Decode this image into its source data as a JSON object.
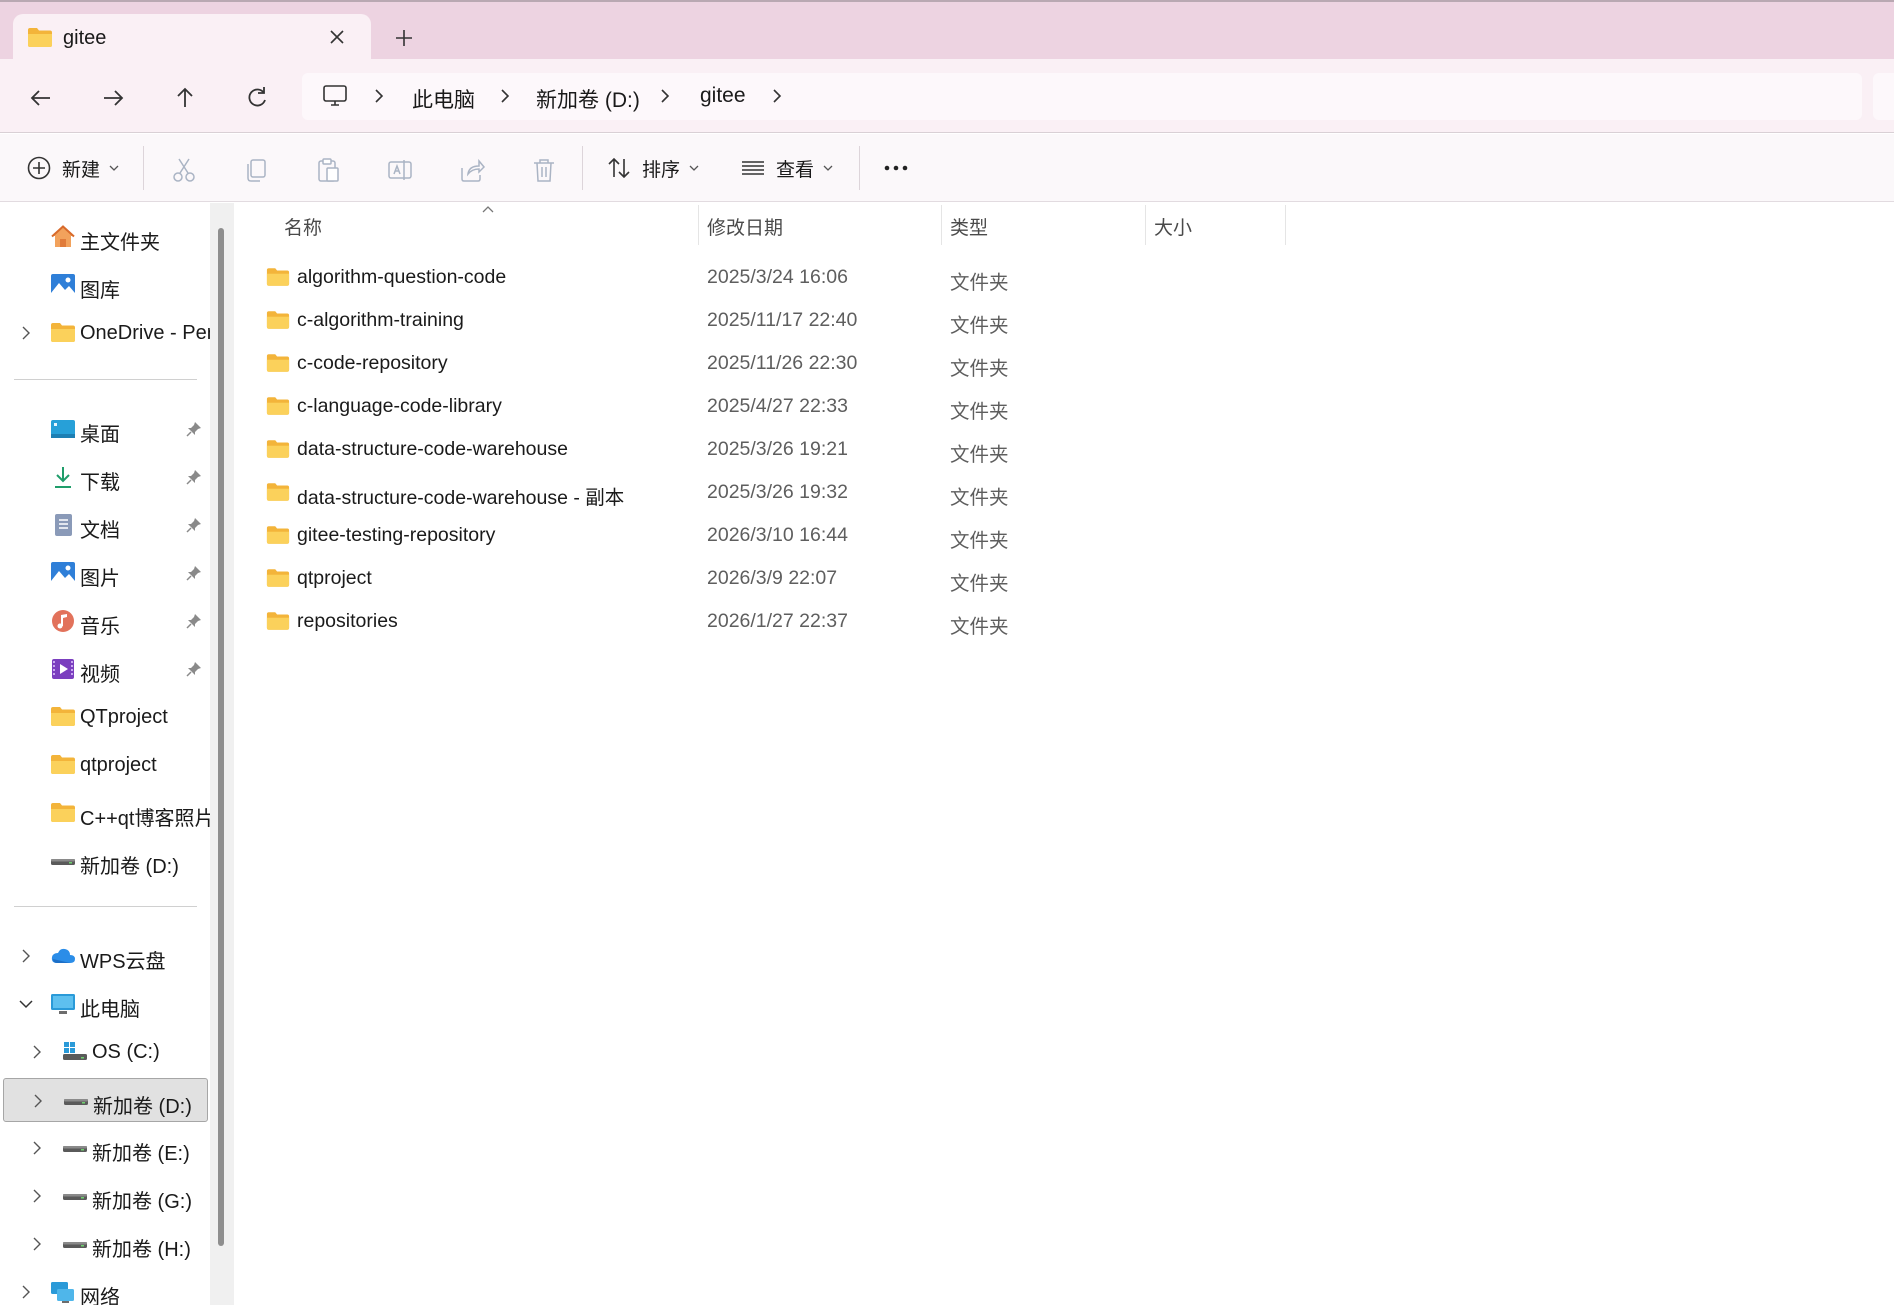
{
  "tab": {
    "title": "gitee",
    "folder_icon": "folder-icon",
    "close_icon": "close-icon"
  },
  "new_tab_icon": "plus-icon",
  "nav_buttons": [
    "back-arrow-icon",
    "forward-arrow-icon",
    "up-arrow-icon",
    "refresh-icon"
  ],
  "breadcrumb": [
    {
      "label": "此电脑"
    },
    {
      "label": "新加卷 (D:)"
    },
    {
      "label": "gitee"
    }
  ],
  "toolbar": {
    "new_label": "新建",
    "sort_label": "排序",
    "view_label": "查看",
    "more_label": "···"
  },
  "sidebar": {
    "quick": [
      {
        "label": "主文件夹",
        "icon": "home-icon"
      },
      {
        "label": "图库",
        "icon": "gallery-icon"
      },
      {
        "label": "OneDrive - Per",
        "icon": "folder-icon"
      }
    ],
    "pinned": [
      {
        "label": "桌面",
        "icon": "desktop-icon",
        "pinned": true
      },
      {
        "label": "下载",
        "icon": "download-icon",
        "pinned": true
      },
      {
        "label": "文档",
        "icon": "document-icon",
        "pinned": true
      },
      {
        "label": "图片",
        "icon": "pictures-icon",
        "pinned": true
      },
      {
        "label": "音乐",
        "icon": "music-icon",
        "pinned": true
      },
      {
        "label": "视频",
        "icon": "video-icon",
        "pinned": true
      },
      {
        "label": "QTproject",
        "icon": "folder-icon"
      },
      {
        "label": "qtproject",
        "icon": "folder-icon"
      },
      {
        "label": "C++qt博客照片",
        "icon": "folder-icon"
      },
      {
        "label": "新加卷 (D:)",
        "icon": "drive-icon"
      }
    ],
    "tree": [
      {
        "label": "WPS云盘",
        "icon": "cloud-icon"
      },
      {
        "label": "此电脑",
        "icon": "computer-icon",
        "expanded": true
      },
      {
        "label": "OS (C:)",
        "icon": "windows-drive-icon"
      },
      {
        "label": "新加卷 (D:)",
        "icon": "drive-icon",
        "selected": true
      },
      {
        "label": "新加卷 (E:)",
        "icon": "drive-icon"
      },
      {
        "label": "新加卷 (G:)",
        "icon": "drive-icon"
      },
      {
        "label": "新加卷 (H:)",
        "icon": "drive-icon"
      },
      {
        "label": "网络",
        "icon": "network-icon"
      }
    ]
  },
  "columns": {
    "name": "名称",
    "date": "修改日期",
    "type": "类型",
    "size": "大小"
  },
  "files": [
    {
      "name": "algorithm-question-code",
      "date": "2025/3/24 16:06",
      "type": "文件夹"
    },
    {
      "name": "c-algorithm-training",
      "date": "2025/11/17 22:40",
      "type": "文件夹"
    },
    {
      "name": "c-code-repository",
      "date": "2025/11/26 22:30",
      "type": "文件夹"
    },
    {
      "name": "c-language-code-library",
      "date": "2025/4/27 22:33",
      "type": "文件夹"
    },
    {
      "name": "data-structure-code-warehouse",
      "date": "2025/3/26 19:21",
      "type": "文件夹"
    },
    {
      "name": "data-structure-code-warehouse - 副本",
      "date": "2025/3/26 19:32",
      "type": "文件夹"
    },
    {
      "name": "gitee-testing-repository",
      "date": "2026/3/10 16:44",
      "type": "文件夹"
    },
    {
      "name": "qtproject",
      "date": "2026/3/9 22:07",
      "type": "文件夹"
    },
    {
      "name": "repositories",
      "date": "2026/1/27 22:37",
      "type": "文件夹"
    }
  ],
  "colors": {
    "titlebar": "#edd3e1",
    "addressbar": "#faf0f5",
    "folder": "#f8c74a",
    "selected": "#e1e1e1"
  }
}
